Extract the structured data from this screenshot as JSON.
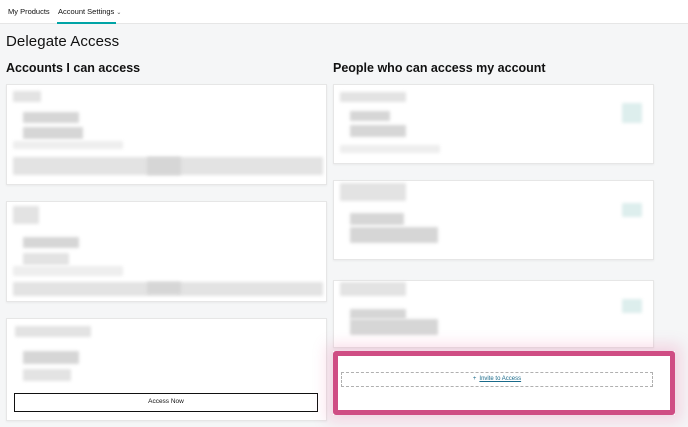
{
  "nav": {
    "tabs": [
      {
        "label": "My Products",
        "active": false
      },
      {
        "label": "Account Settings",
        "active": true,
        "chevron": "⌄"
      }
    ],
    "accent_color": "#00a4a6"
  },
  "page": {
    "title": "Delegate Access"
  },
  "sections": {
    "accounts_i_can_access": {
      "title": "Accounts I can access",
      "access_button_label": "Access Now"
    },
    "people_who_can_access": {
      "title": "People who can access my account",
      "invite_icon": "plus-icon",
      "invite_label": "Invite to Access",
      "highlight_color": "#cf4d84"
    }
  }
}
